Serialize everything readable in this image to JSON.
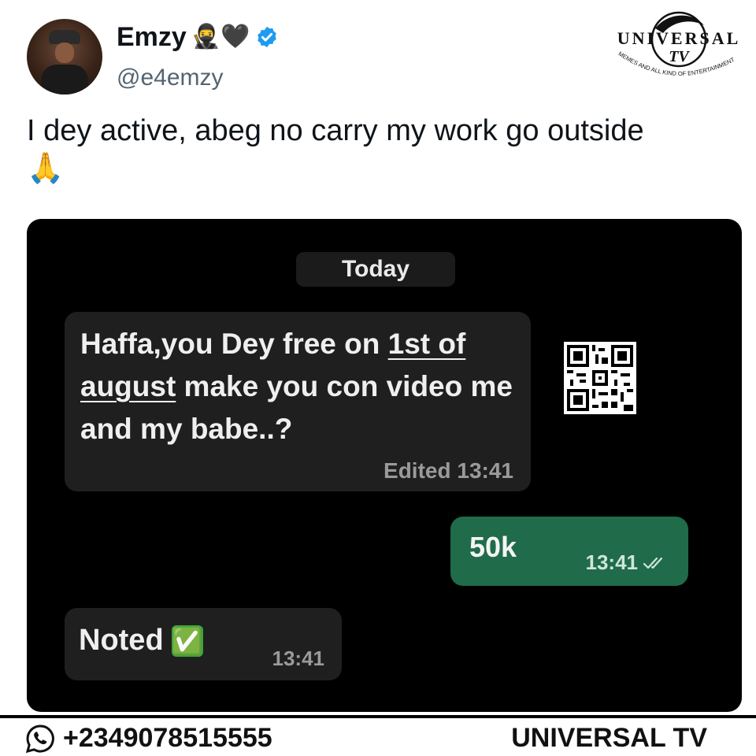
{
  "tweet": {
    "author_name": "Emzy",
    "name_emojis": "🥷🖤",
    "handle": "@e4emzy",
    "text_line1": "I dey active, abeg no carry my work go outside",
    "text_emoji": "🙏",
    "verified_icon": "verified-badge-icon"
  },
  "logo": {
    "title": "UNIVERSAL",
    "monogram": "TV",
    "tagline": "MEMES AND ALL KIND OF ENTERTAINMENT"
  },
  "chat": {
    "date_label": "Today",
    "messages": [
      {
        "direction": "incoming",
        "text_parts": [
          "Haffa,you Dey free on ",
          "1st of august",
          " make you con video me and my babe..?"
        ],
        "edited_label": "Edited",
        "time": "13:41"
      },
      {
        "direction": "outgoing",
        "text": "50k",
        "time": "13:41",
        "status_icon": "double-check-icon"
      },
      {
        "direction": "incoming",
        "text": "Noted",
        "emoji": "✅",
        "time": "13:41"
      }
    ],
    "bubble_colors": {
      "incoming": "#1f1f1f",
      "outgoing": "#1f6b4a",
      "background": "#000000"
    }
  },
  "footer": {
    "phone": "+2349078515555",
    "brand": "UNIVERSAL TV",
    "phone_icon": "whatsapp-icon"
  }
}
